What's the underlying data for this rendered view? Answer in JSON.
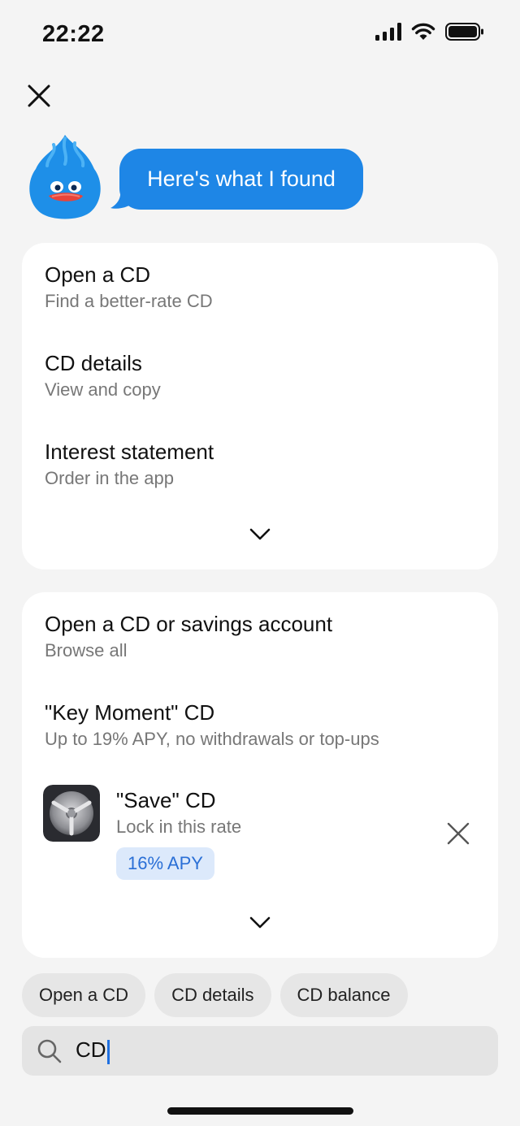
{
  "status_bar": {
    "time": "22:22"
  },
  "assistant": {
    "message": "Here's what I found"
  },
  "card1": {
    "items": [
      {
        "title": "Open a CD",
        "subtitle": "Find a better-rate CD"
      },
      {
        "title": "CD details",
        "subtitle": "View and copy"
      },
      {
        "title": "Interest statement",
        "subtitle": "Order in the app"
      }
    ]
  },
  "card2": {
    "items": [
      {
        "title": "Open a CD or savings account",
        "subtitle": "Browse all"
      },
      {
        "title": "\"Key Moment\" CD",
        "subtitle": "Up to 19% APY, no withdrawals or top-ups"
      },
      {
        "title": "\"Save\" CD",
        "subtitle": "Lock in this rate",
        "badge": "16% APY"
      }
    ]
  },
  "chips": [
    "Open a CD",
    "CD details",
    "CD balance"
  ],
  "search": {
    "value": "CD"
  },
  "colors": {
    "accent": "#1e86e6",
    "badge_bg": "#dce9fb",
    "badge_text": "#2a6fd6"
  },
  "icons": [
    "signal-icon",
    "wifi-icon",
    "battery-icon",
    "close-icon",
    "mascot-icon",
    "chevron-down-icon",
    "safe-icon",
    "search-icon"
  ]
}
